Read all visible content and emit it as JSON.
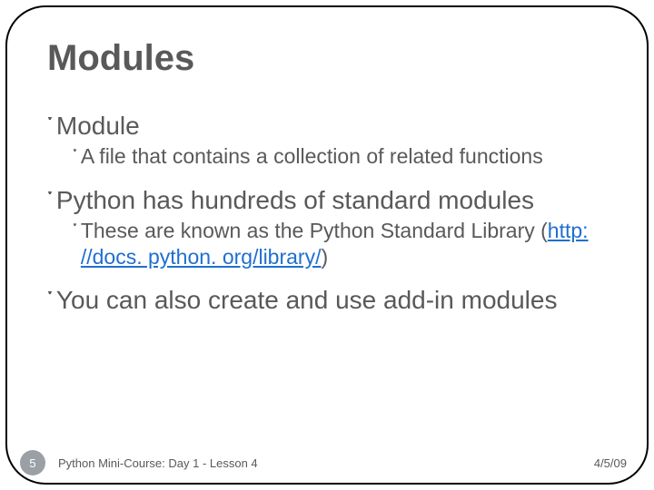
{
  "title": "Modules",
  "bullets": {
    "b1": "Module",
    "b1a": "A file that contains a collection of related functions",
    "b2": "Python has hundreds of standard modules",
    "b2a_pre": "These are known as the Python Standard Library (",
    "b2a_link": "http: //docs. python. org/library/",
    "b2a_post": ")",
    "b3": "You can also create and use add-in modules"
  },
  "glyph": "་",
  "footer": {
    "page": "5",
    "course": "Python Mini-Course: Day 1 - Lesson 4",
    "date": "4/5/09"
  }
}
